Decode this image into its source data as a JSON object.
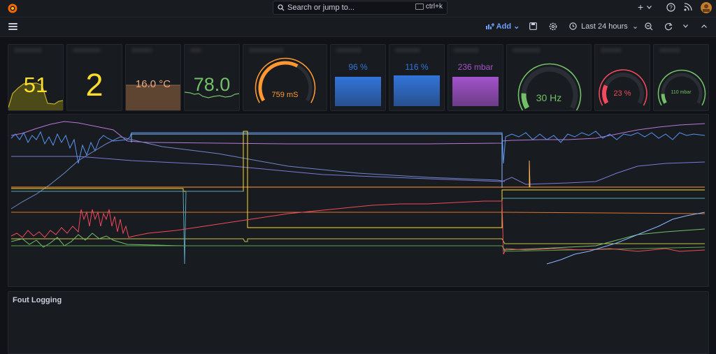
{
  "search": {
    "placeholder": "Search or jump to...",
    "shortcut": "ctrl+k"
  },
  "toolbar": {
    "add_label": "Add",
    "time_range": "Last 24 hours"
  },
  "panels": [
    {
      "kind": "stat",
      "value": "51",
      "color": "#fade2a"
    },
    {
      "kind": "stat",
      "value": "2",
      "color": "#fade2a"
    },
    {
      "kind": "stat",
      "value": "16.0 °C",
      "color": "#f0a97d"
    },
    {
      "kind": "stat",
      "value": "78.0",
      "color": "#73bf69"
    },
    {
      "kind": "gauge",
      "value": "759 mS",
      "color": "#ff9830",
      "level": 0.62
    },
    {
      "kind": "bar",
      "value": "96 %",
      "color": "#3274d9",
      "level": 0.96
    },
    {
      "kind": "bar",
      "value": "116 %",
      "color": "#3274d9",
      "level": 1.0
    },
    {
      "kind": "bar",
      "value": "236 mbar",
      "color": "#a352cc",
      "level": 0.96
    },
    {
      "kind": "gauge",
      "value": "30 Hz",
      "color": "#73bf69",
      "level": 0.14
    },
    {
      "kind": "gauge",
      "value": "23 %",
      "color": "#f2495c",
      "level": 0.23
    },
    {
      "kind": "gauge",
      "value": "110 mbar",
      "color": "#73bf69",
      "level": 0.12
    }
  ],
  "log_panel": {
    "title": "Fout Logging"
  },
  "colors": {
    "background": "#111217",
    "panel": "#181b1f",
    "accent": "#6e9fff",
    "yellow": "#fade2a",
    "green": "#73bf69",
    "orange": "#ff9830",
    "red": "#f2495c",
    "blue": "#5794f2",
    "purple": "#b877d9",
    "teal": "#8ab8ff"
  }
}
